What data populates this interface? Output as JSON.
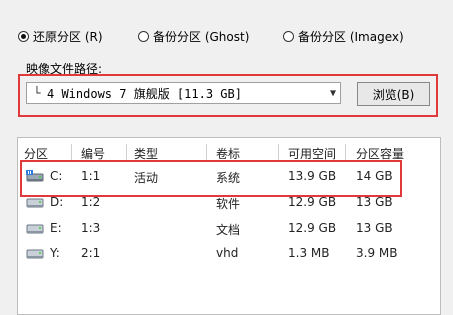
{
  "options": {
    "restore": "还原分区 (R)",
    "backup_ghost": "备份分区 (Ghost)",
    "backup_imagex": "备份分区 (Imagex)"
  },
  "image": {
    "label": "映像文件路径:",
    "selected": "4 Windows 7 旗舰版 [11.3 GB]",
    "browse": "浏览(B)"
  },
  "table": {
    "headers": [
      "分区",
      "编号",
      "类型",
      "卷标",
      "可用空间",
      "分区容量"
    ],
    "rows": [
      {
        "partition": "C:",
        "number": "1:1",
        "type": "活动",
        "label": "系统",
        "free": "13.9 GB",
        "size": "14 GB"
      },
      {
        "partition": "D:",
        "number": "1:2",
        "type": "",
        "label": "软件",
        "free": "12.9 GB",
        "size": "13 GB"
      },
      {
        "partition": "E:",
        "number": "1:3",
        "type": "",
        "label": "文档",
        "free": "12.9 GB",
        "size": "13 GB"
      },
      {
        "partition": "Y:",
        "number": "2:1",
        "type": "",
        "label": "vhd",
        "free": "1.3 MB",
        "size": "3.9 MB"
      }
    ]
  },
  "colors": {
    "highlight": "#e0393b"
  }
}
